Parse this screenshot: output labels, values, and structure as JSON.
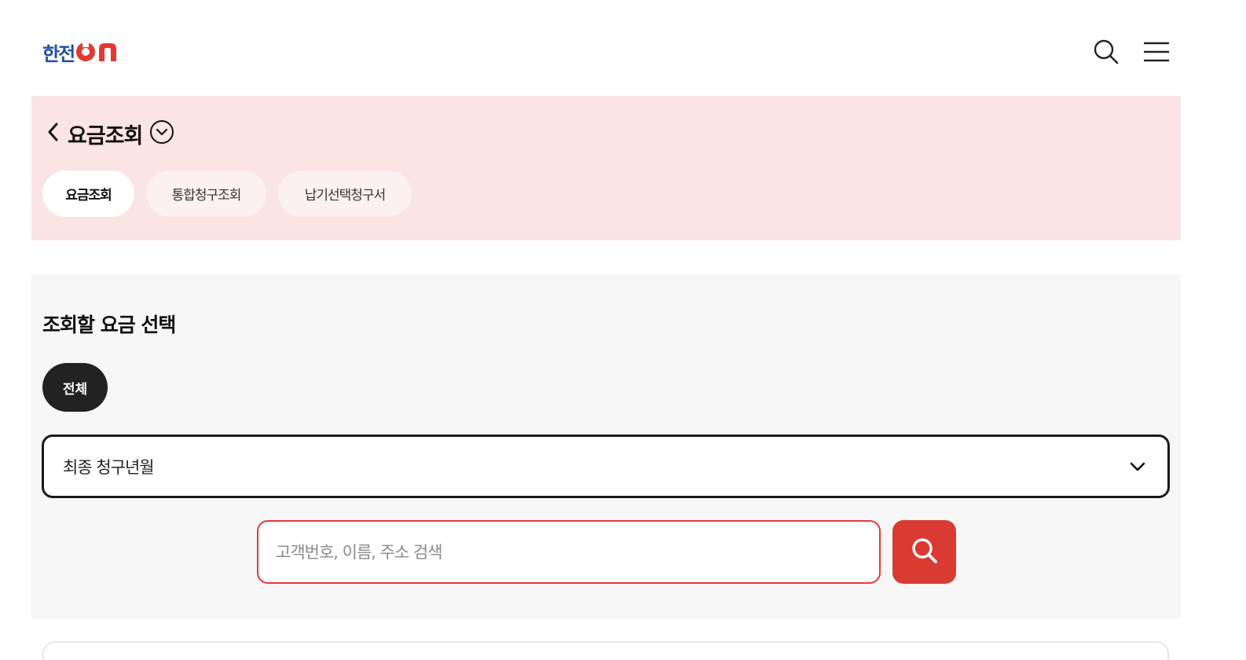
{
  "header": {
    "logo": {
      "text": "한전",
      "brand_color": "#1f4fa8",
      "accent_color": "#e53935",
      "suffix_icon": "on-logo-icon"
    },
    "icons": [
      "search-icon",
      "hamburger-menu-icon"
    ]
  },
  "banner": {
    "background": "#fae4e4",
    "title": "요금조회",
    "back_icon": "chevron-left-icon",
    "toggle_icon": "chevron-down-circle-icon",
    "tabs": [
      {
        "label": "요금조회",
        "active": true
      },
      {
        "label": "통합청구조회",
        "active": false
      },
      {
        "label": "납기선택청구서",
        "active": false
      }
    ]
  },
  "panel": {
    "title": "조회할 요금 선택",
    "chip": {
      "label": "전체",
      "active": true
    },
    "select": {
      "value": "최종 청구년월",
      "icon": "chevron-down-icon"
    },
    "search": {
      "placeholder": "고객번호, 이름, 주소 검색",
      "value": "",
      "button_icon": "search-icon",
      "button_color": "#d93a31"
    }
  }
}
